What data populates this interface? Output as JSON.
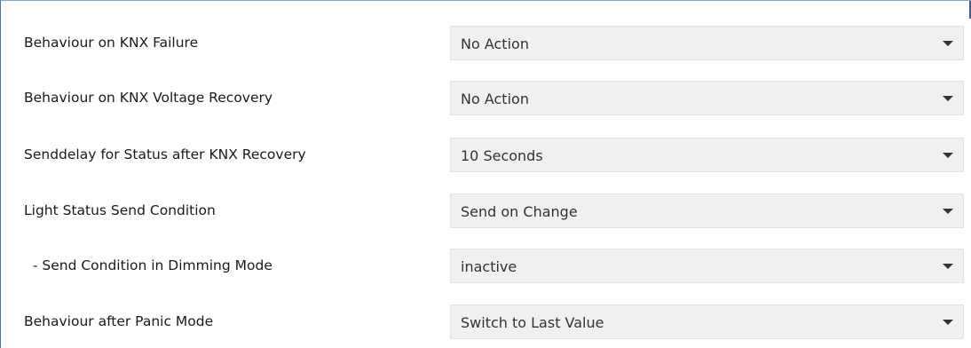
{
  "settings": {
    "rows": [
      {
        "label": "Behaviour on KNX Failure",
        "value": "No Action"
      },
      {
        "label": "Behaviour on KNX Voltage Recovery",
        "value": "No Action"
      },
      {
        "label": "Senddelay for Status after KNX Recovery",
        "value": "10 Seconds"
      },
      {
        "label": "Light Status Send Condition",
        "value": "Send on Change"
      },
      {
        "label": "  - Send Condition in Dimming Mode",
        "value": "inactive"
      },
      {
        "label": "Behaviour after Panic Mode",
        "value": "Switch to Last Value"
      }
    ]
  },
  "icons": {
    "dropdown": "chevron-down-icon"
  }
}
